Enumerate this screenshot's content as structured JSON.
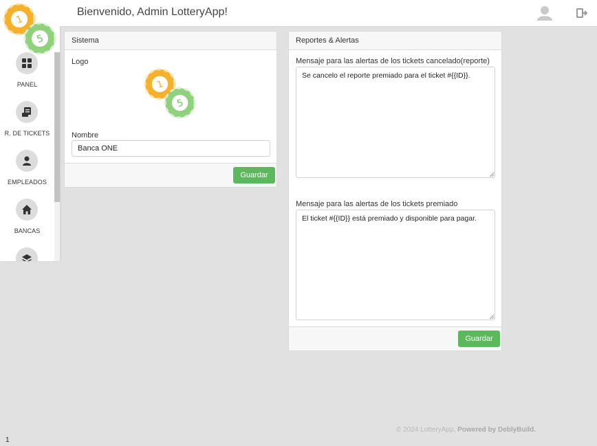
{
  "header": {
    "title": "Bienvenido, Admin LotteryApp!",
    "icons": [
      "user-avatar-icon",
      "logout-icon"
    ]
  },
  "sidebar": {
    "items": [
      {
        "label": "PANEL",
        "icon": "dashboard-grid-icon"
      },
      {
        "label": "R. DE TICKETS",
        "icon": "ticket-register-icon"
      },
      {
        "label": "EMPLEADOS",
        "icon": "employee-user-icon"
      },
      {
        "label": "BANCAS",
        "icon": "home-icon"
      },
      {
        "label": "",
        "icon": "layers-icon"
      }
    ]
  },
  "system_card": {
    "header": "Sistema",
    "logo_label": "Logo",
    "name_label": "Nombre",
    "name_value": "Banca ONE",
    "save_label": "Guardar"
  },
  "alerts_card": {
    "header": "Reportes & Alertas",
    "cancel_label": "Mensaje para las alertas de los tickets cancelado(reporte)",
    "cancel_value": "Se cancelo el reporte premiado para el ticket #{{ID}}.",
    "winner_label": "Mensaje para las alertas de los tickets premiado",
    "winner_value": "El ticket #{{ID}} está premiado y disponible para pagar.",
    "save_label": "Guardar"
  },
  "footer": {
    "copyright": "© 2024 LotteryApp,",
    "powered_by": "Powered by DeblyBuild."
  },
  "page_number": "1",
  "colors": {
    "accent_green": "#5cb85c",
    "background": "#e1e1e1",
    "ball_orange": "#f5b12c",
    "ball_green": "#8fd17c"
  }
}
